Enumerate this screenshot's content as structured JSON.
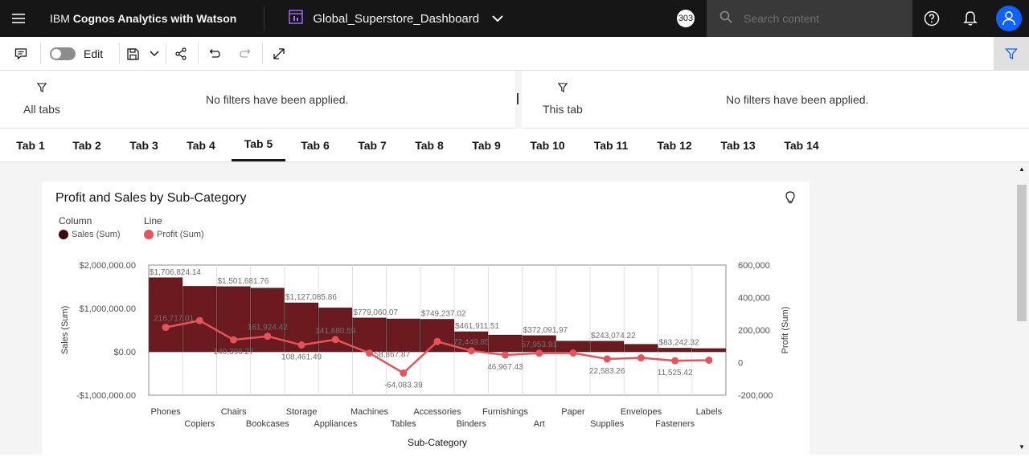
{
  "topbar": {
    "brand_prefix": "IBM ",
    "brand_bold": "Cognos Analytics with Watson",
    "dashboard_name": "Global_Superstore_Dashboard",
    "badge_count": "303",
    "search_placeholder": "Search content"
  },
  "toolbar": {
    "edit_label": "Edit"
  },
  "filters": {
    "all_tabs_label": "All tabs",
    "all_tabs_message": "No filters have been applied.",
    "this_tab_label": "This tab",
    "this_tab_message": "No filters have been applied."
  },
  "tabs": [
    {
      "label": "Tab 1"
    },
    {
      "label": "Tab 2"
    },
    {
      "label": "Tab 3"
    },
    {
      "label": "Tab 4"
    },
    {
      "label": "Tab 5",
      "active": true
    },
    {
      "label": "Tab 6"
    },
    {
      "label": "Tab 7"
    },
    {
      "label": "Tab 8"
    },
    {
      "label": "Tab 9"
    },
    {
      "label": "Tab 10"
    },
    {
      "label": "Tab 11"
    },
    {
      "label": "Tab 12"
    },
    {
      "label": "Tab 13"
    },
    {
      "label": "Tab 14"
    }
  ],
  "widget": {
    "title": "Profit and Sales by Sub-Category",
    "legend_column_title": "Column",
    "legend_line_title": "Line"
  },
  "colors": {
    "sales": "#6b1a1f",
    "profit": "#e5545a",
    "accent": "#0f62fe"
  },
  "chart_data": {
    "type": "bar",
    "title": "Profit and Sales by Sub-Category",
    "xlabel": "Sub-Category",
    "ylabel": "Sales (Sum)",
    "y2label": "Profit (Sum)",
    "ylim": [
      -1000000,
      2000000
    ],
    "y2lim": [
      -200000,
      600000
    ],
    "yticks": [
      "$2,000,000.00",
      "$1,000,000.00",
      "$0.00",
      "-$1,000,000.00"
    ],
    "y2ticks": [
      "600,000",
      "400,000",
      "200,000",
      "0",
      "-200,000"
    ],
    "categories": [
      "Phones",
      "Copiers",
      "Chairs",
      "Bookcases",
      "Storage",
      "Appliances",
      "Machines",
      "Tables",
      "Accessories",
      "Binders",
      "Furnishings",
      "Art",
      "Paper",
      "Supplies",
      "Envelopes",
      "Fasteners",
      "Labels"
    ],
    "series": [
      {
        "name": "Sales (Sum)",
        "kind": "column",
        "values": [
          1706824.14,
          1509436.27,
          1501681.76,
          1466572.24,
          1127085.86,
          1011064.3,
          779060.07,
          757041.92,
          749237.02,
          461911.51,
          385578.26,
          372091.97,
          244291.72,
          243074.22,
          170904.3,
          83242.32,
          73404.03
        ],
        "labels": [
          "$1,706,824.14",
          "",
          "$1,501,681.76",
          "",
          "$1,127,085.86",
          "",
          "$779,060.07",
          "",
          "$749,237.02",
          "$461,911.51",
          "",
          "$372,091.97",
          "",
          "$243,074.22",
          "",
          "$83,242.32",
          ""
        ]
      },
      {
        "name": "Profit (Sum)",
        "kind": "line",
        "values": [
          216717.01,
          258567.55,
          140396.27,
          161924.42,
          108461.49,
          141680.59,
          58867.87,
          -64083.39,
          129626.31,
          72449.85,
          46967.43,
          57953.91,
          59207.68,
          22583.26,
          29601.12,
          11525.42,
          15010.51
        ],
        "labels": [
          "216,717.01",
          "",
          "140,396.27",
          "161,924.42",
          "108,461.49",
          "141,680.59",
          "58,867.87",
          "-64,083.39",
          "",
          "72,449.85",
          "46,967.43",
          "57,953.91",
          "",
          "22,583.26",
          "",
          "11,525.42",
          ""
        ]
      }
    ],
    "legend_position": "top-left",
    "grid": "vertical"
  }
}
